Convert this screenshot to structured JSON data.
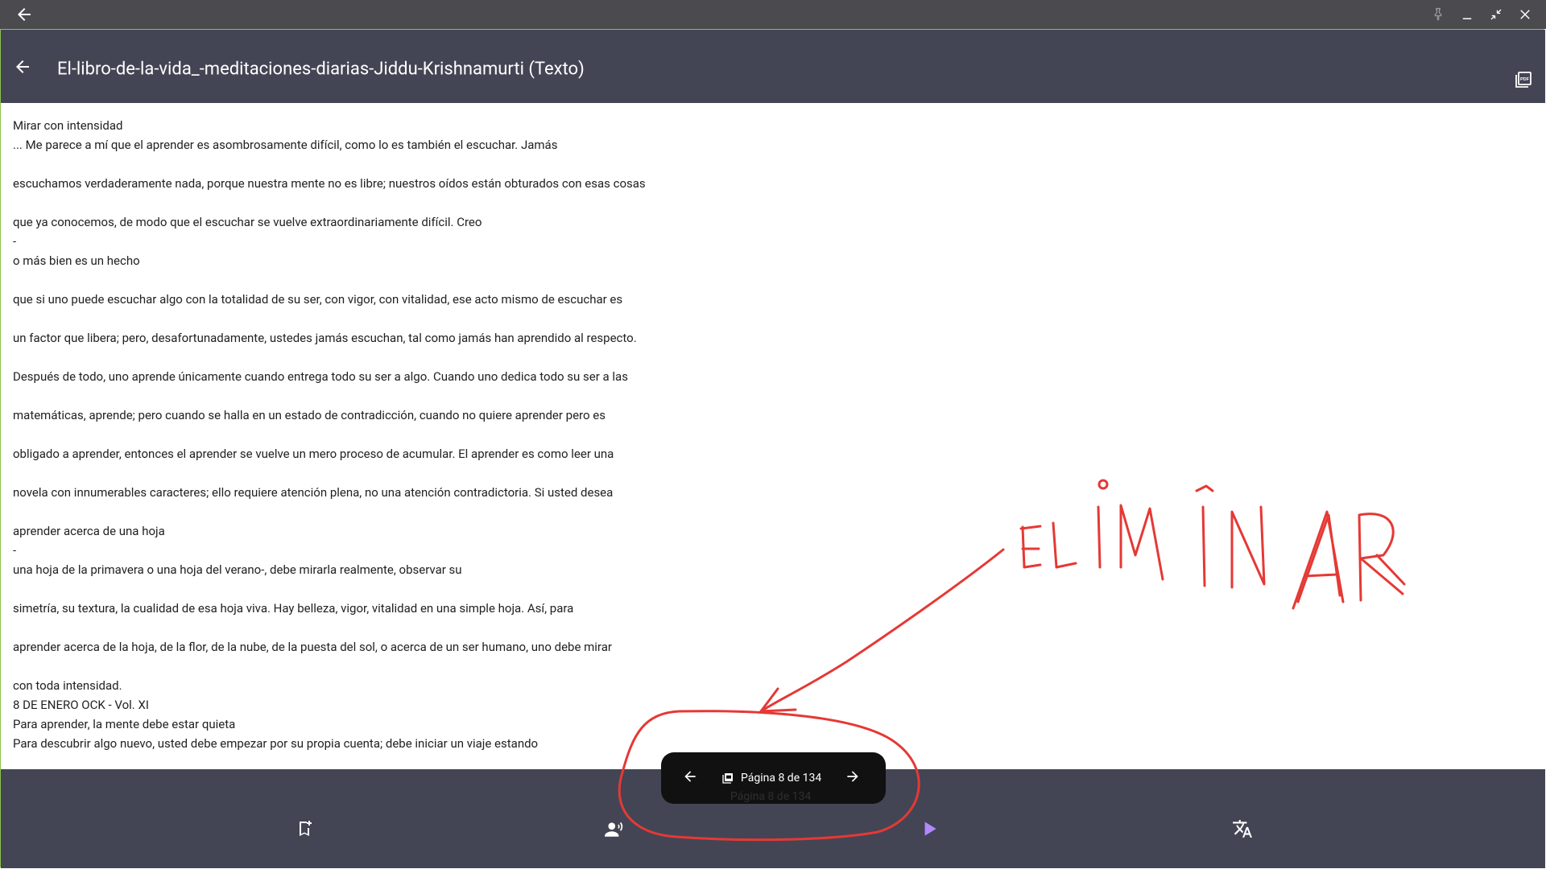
{
  "window": {
    "frame_color": "#8bc34a",
    "titlebar_color": "#4a4a4f"
  },
  "appbar": {
    "title": "El-libro-de-la-vida_-meditaciones-diarias-Jiddu-Krishnamurti (Texto)",
    "background": "#434554",
    "back_icon": "arrow-left-icon",
    "pdf_icon": "pdf-icon"
  },
  "content": {
    "text": "Mirar con intensidad\n... Me parece a mí que el aprender es asombrosamente difícil, como lo es también el escuchar. Jamás\n\nescuchamos verdaderamente nada, porque nuestra mente no es libre; nuestros oídos están obturados con esas cosas\n\nque ya conocemos, de modo que el escuchar se vuelve extraordinariamente difícil. Creo\n-\no más bien es un hecho\n\nque si uno puede escuchar algo con la totalidad de su ser, con vigor, con vitalidad, ese acto mismo de escuchar es\n\nun factor que libera; pero, desafortunadamente, ustedes jamás escuchan, tal como jamás han aprendido al respecto.\n\nDespués de todo, uno aprende únicamente cuando entrega todo su ser a algo. Cuando uno dedica todo su ser a las\n\nmatemáticas, aprende; pero cuando se halla en un estado de contradicción, cuando no quiere aprender pero es\n\nobligado a aprender, entonces el aprender se vuelve un mero proceso de acumular. El aprender es como leer una\n\nnovela con innumerables caracteres; ello requiere atención plena, no una atención contradictoria. Si usted desea\n\naprender acerca de una hoja\n-\nuna hoja de la primavera o una hoja del verano-, debe mirarla realmente, observar su\n\nsimetría, su textura, la cualidad de esa hoja viva. Hay belleza, vigor, vitalidad en una simple hoja. Así, para\n\naprender acerca de la hoja, de la flor, de la nube, de la puesta del sol, o acerca de un ser humano, uno debe mirar\n\ncon toda intensidad.\n8 DE ENERO OCK - Vol. XI\nPara aprender, la mente debe estar quieta\nPara descubrir algo nuevo, usted debe empezar por su propia cuenta; debe iniciar un viaje estando"
  },
  "pager": {
    "label": "Página 8 de 134",
    "ghost_label": "Página 8 de 134",
    "prev_icon": "arrow-left-icon",
    "next_icon": "arrow-right-icon",
    "pdf_icon": "pdf-small-icon"
  },
  "bottom_nav": {
    "background": "#434554",
    "items": [
      {
        "icon": "bookmark-add-icon"
      },
      {
        "icon": "record-voice-icon"
      },
      {
        "icon": "play-icon",
        "color": "#b388ff"
      },
      {
        "icon": "translate-icon"
      }
    ]
  },
  "annotation": {
    "text": "ELIMINAR",
    "color": "#e53935"
  }
}
